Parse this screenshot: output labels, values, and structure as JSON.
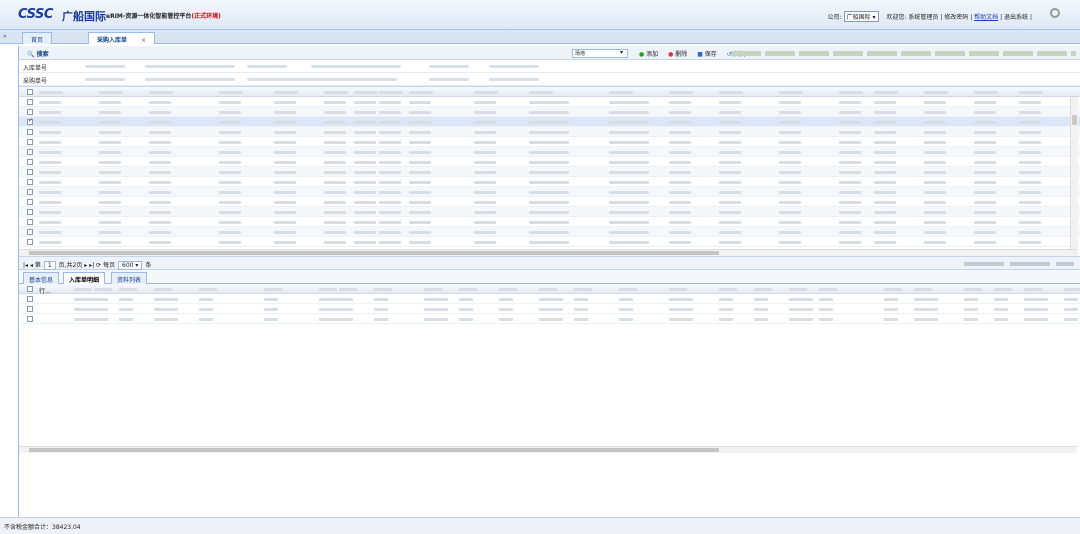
{
  "header": {
    "logo": "CSSC",
    "logo_cn": "广船国际",
    "system": "eRIM-资源一体化智能管控平台",
    "env": "(正式环境)",
    "company_label": "公司:",
    "company": "广船国际",
    "welcome": "欢迎您: 系统管理员",
    "change_pwd": "修改密码",
    "help": "帮助文档",
    "logout": "退出系统",
    "sep": "|"
  },
  "tabs": {
    "collapse": "»",
    "home": "首页",
    "active": "采购入库单",
    "close": "×"
  },
  "toolbar": {
    "search": "搜索",
    "select": "场地",
    "arrow": "▾",
    "add": "添加",
    "delete": "删除",
    "save": "保存",
    "close": "关闭"
  },
  "filters": {
    "row1": "入库单号",
    "row2": "采购单号"
  },
  "pager": {
    "first": "|◂",
    "prev": "◂",
    "page_label": "第",
    "page": "1",
    "page_total": "页,共2页",
    "next": "▸",
    "last": "▸|",
    "refresh": "⟳",
    "per_label": "每页",
    "per": "600",
    "per_unit": "条"
  },
  "subtabs": {
    "t1": "基本信息",
    "t2": "入库单明细",
    "t3": "资料列表"
  },
  "detail": {
    "row_header": "行..."
  },
  "footer": {
    "total": "不含税金额合计：38423.04"
  },
  "grid": {
    "rows": 15,
    "checked_row": 3
  },
  "detail_grid": {
    "rows": 3
  }
}
